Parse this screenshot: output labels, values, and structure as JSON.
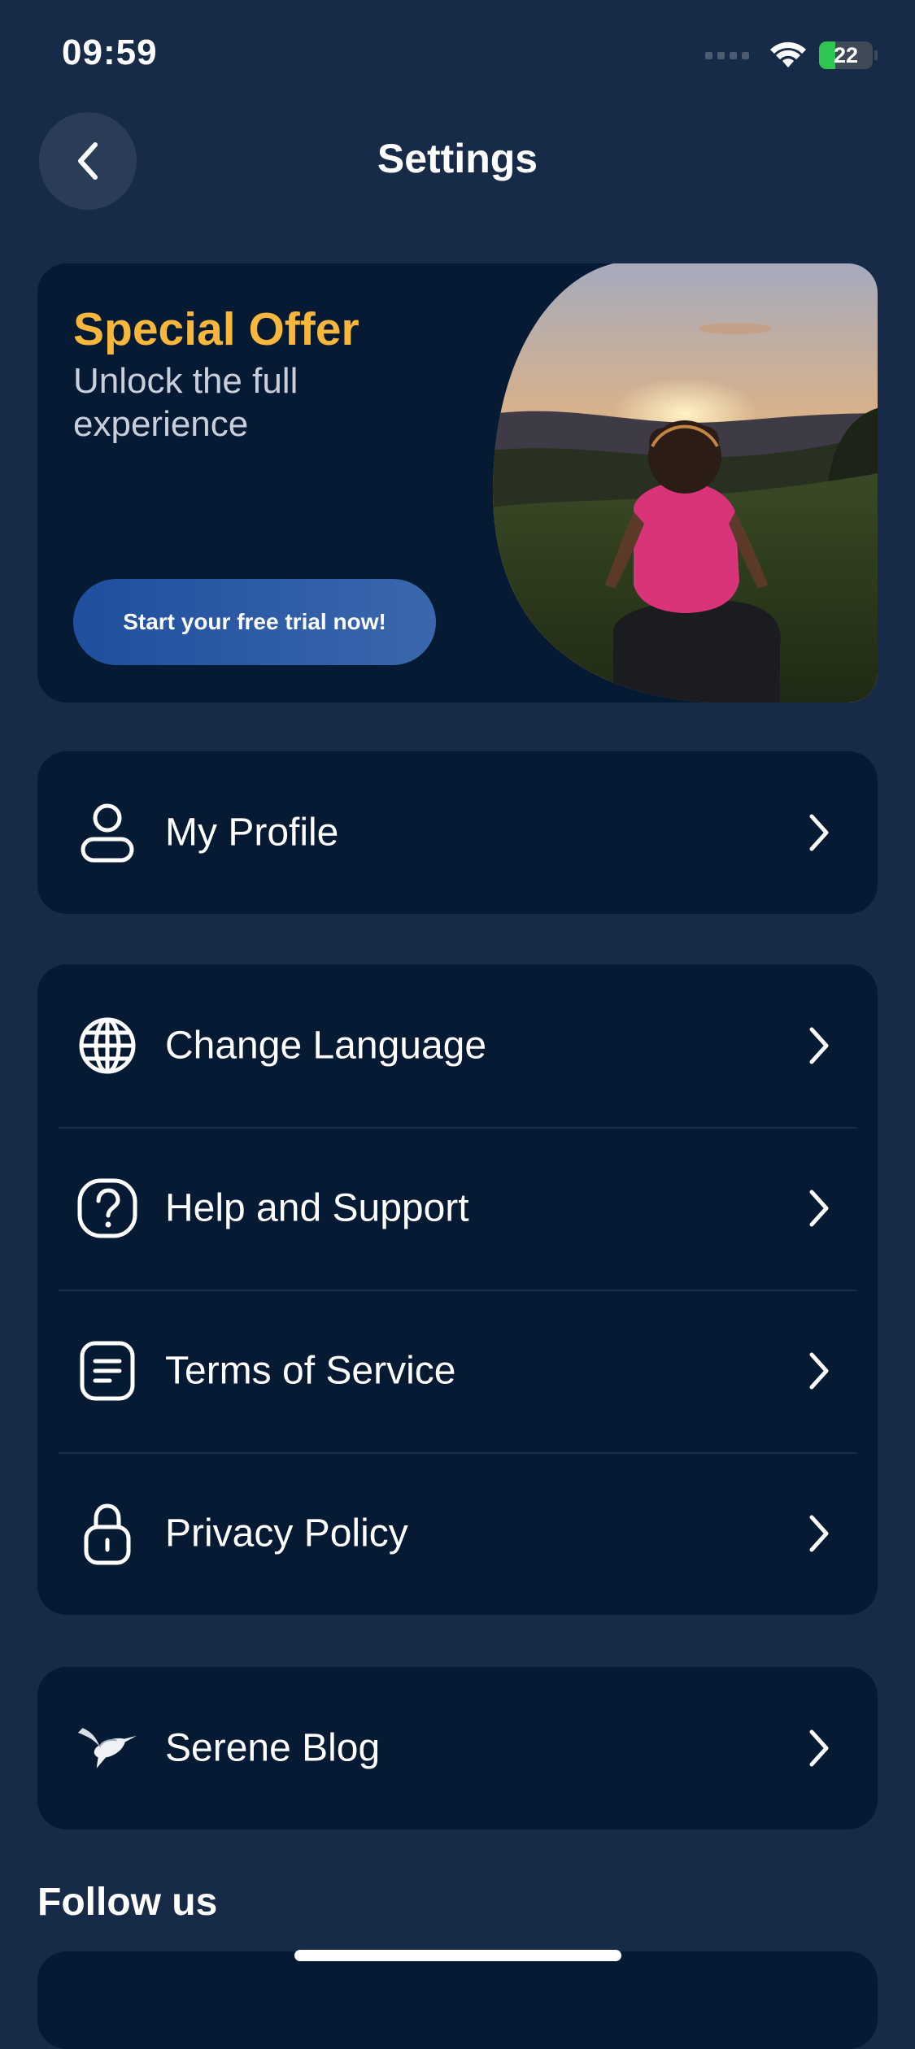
{
  "status_bar": {
    "time": "09:59",
    "battery": "22",
    "icons": [
      "signal-dots-icon",
      "wifi-icon",
      "battery-charging-icon"
    ]
  },
  "header": {
    "title": "Settings",
    "back_icon": "chevron-left-icon"
  },
  "offer": {
    "title": "Special Offer",
    "subtitle": "Unlock the full experience",
    "button_label": "Start your free trial now!",
    "image": "person-meditating-at-sunset-photo"
  },
  "groups": {
    "profile": [
      {
        "label": "My Profile",
        "icon": "person-icon"
      }
    ],
    "settings": [
      {
        "label": "Change Language",
        "icon": "globe-icon"
      },
      {
        "label": "Help and Support",
        "icon": "question-icon"
      },
      {
        "label": "Terms of Service",
        "icon": "document-icon"
      },
      {
        "label": "Privacy Policy",
        "icon": "lock-icon"
      }
    ],
    "blog": [
      {
        "label": "Serene Blog",
        "icon": "hummingbird-icon"
      }
    ]
  },
  "follow": {
    "title": "Follow us"
  },
  "colors": {
    "background": "#172b48",
    "card": "#071a33",
    "accent": "#f6b73c",
    "button": "#2a5aa8"
  }
}
